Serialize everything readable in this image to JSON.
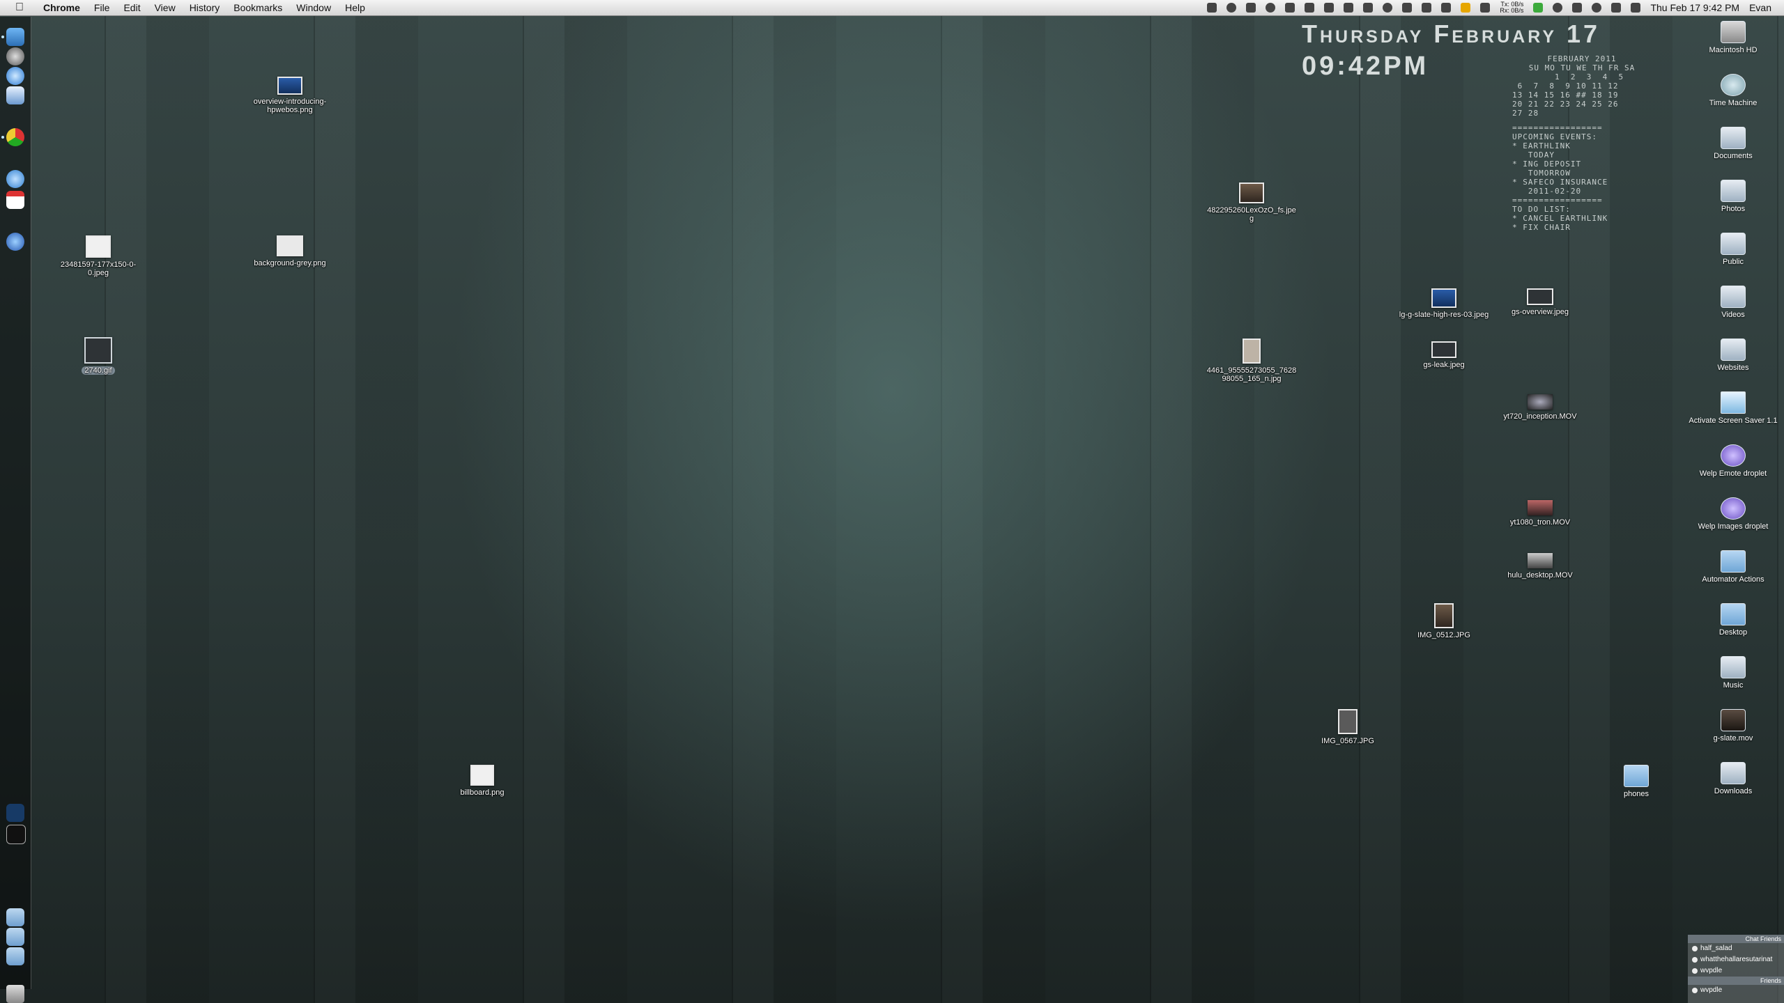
{
  "menubar": {
    "app_name": "Chrome",
    "menus": [
      "File",
      "Edit",
      "View",
      "History",
      "Bookmarks",
      "Window",
      "Help"
    ],
    "clock": "Thu Feb 17  9:42 PM",
    "user": "Evan",
    "network_rate_up": "0B/s",
    "network_rate_down": "0B/s",
    "tx_label": "Tx:",
    "rx_label": "Rx:"
  },
  "clock_widget": {
    "date": "Thursday February 17",
    "time": "09:42PM"
  },
  "calendar": {
    "month_title": "February 2011",
    "weekday_header": "Su Mo Tu We Th Fr Sa",
    "weeks": [
      "        1  2  3  4  5",
      " 6  7  8  9 10 11 12",
      "13 14 15 16 ## 18 19",
      "20 21 22 23 24 25 26",
      "27 28"
    ],
    "divider": "=================",
    "events_title": "Upcoming Events:",
    "events": [
      "* Earthlink",
      "   today",
      "* ING deposit",
      "   tomorrow",
      "* Safeco insurance",
      "   2011-02-20"
    ],
    "todo_title": "To Do List:",
    "todos": [
      "* cancel earthlink",
      "* fix chair"
    ]
  },
  "desktop_files": [
    {
      "name": "overview-introducing-hpwebos.png"
    },
    {
      "name": "23481597-177x150-0-0.jpeg"
    },
    {
      "name": "background-grey.png"
    },
    {
      "name": "2740.gif"
    },
    {
      "name": "482295260LexOzO_fs.jpeg"
    },
    {
      "name": "lg-g-slate-high-res-03.jpeg"
    },
    {
      "name": "gs-overview.jpeg"
    },
    {
      "name": "4461_95555273055_762898055_165_n.jpg"
    },
    {
      "name": "gs-leak.jpeg"
    },
    {
      "name": "yt720_inception.MOV"
    },
    {
      "name": "yt1080_tron.MOV"
    },
    {
      "name": "hulu_desktop.MOV"
    },
    {
      "name": "IMG_0512.JPG"
    },
    {
      "name": "IMG_0567.JPG"
    },
    {
      "name": "billboard.png"
    },
    {
      "name": "phones"
    }
  ],
  "right_column": [
    {
      "name": "Macintosh HD",
      "icon": "hard-drive"
    },
    {
      "name": "Time Machine",
      "icon": "time-machine"
    },
    {
      "name": "Documents",
      "icon": "network-volume"
    },
    {
      "name": "Photos",
      "icon": "network-volume"
    },
    {
      "name": "Public",
      "icon": "network-volume"
    },
    {
      "name": "Videos",
      "icon": "network-volume"
    },
    {
      "name": "Websites",
      "icon": "network-volume"
    },
    {
      "name": "Activate Screen Saver 1.1",
      "icon": "screensaver-app"
    },
    {
      "name": "Welp Emote droplet",
      "icon": "droplet"
    },
    {
      "name": "Welp Images droplet",
      "icon": "droplet"
    },
    {
      "name": "Automator Actions",
      "icon": "folder"
    },
    {
      "name": "Desktop",
      "icon": "folder"
    },
    {
      "name": "Music",
      "icon": "network-volume"
    },
    {
      "name": "g-slate.mov",
      "icon": "movie"
    },
    {
      "name": "Downloads",
      "icon": "network-volume"
    }
  ],
  "chat": {
    "group1": "Chat Friends",
    "buddies1": [
      "half_salad",
      "whatthehallaresutarinat",
      "wvpdle"
    ],
    "group2": "Friends",
    "buddies2": [
      "wvpdle"
    ]
  },
  "colors": {
    "wallpaper_base": "#2c3938",
    "menubar": "#e4e4e4",
    "widget_text": "#d7dddc"
  }
}
